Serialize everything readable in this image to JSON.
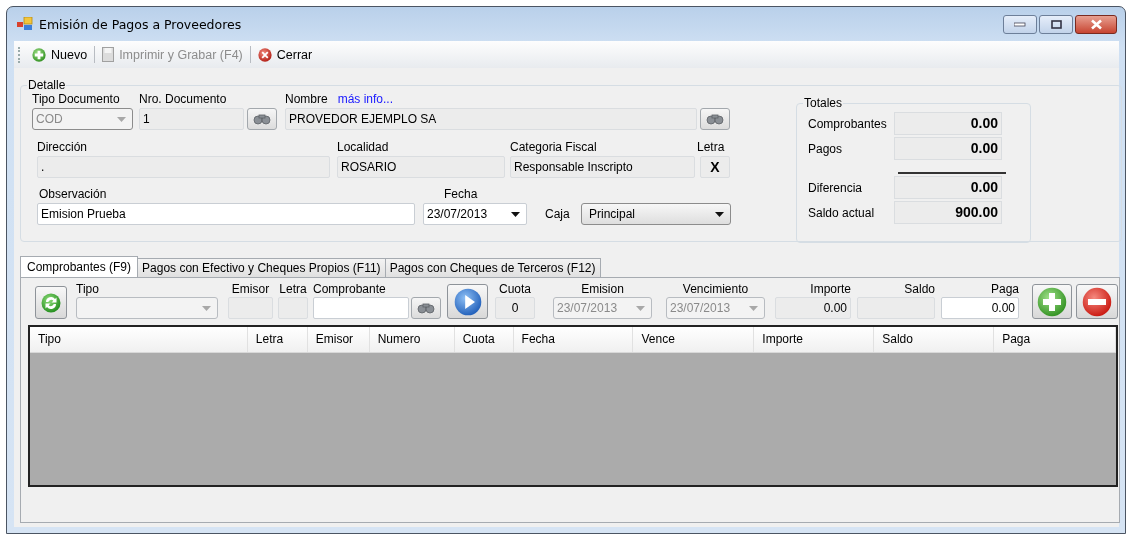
{
  "window": {
    "title": "Emisión de Pagos a Proveedores"
  },
  "toolbar": [
    {
      "kind": "new",
      "label": "Nuevo",
      "disabled": false
    },
    {
      "kind": "print",
      "label": "Imprimir y Grabar (F4)",
      "disabled": true
    },
    {
      "kind": "close",
      "label": "Cerrar",
      "disabled": false
    }
  ],
  "detalle": {
    "title": "Detalle",
    "tipo_documento": {
      "label": "Tipo Documento",
      "value": "COD",
      "disabled": true
    },
    "nro_documento": {
      "label": "Nro. Documento",
      "value": "1",
      "disabled": true
    },
    "nombre": {
      "label": "Nombre",
      "link": "más info...",
      "value": "PROVEDOR EJEMPLO SA",
      "disabled": true
    },
    "direccion": {
      "label": "Dirección",
      "value": ".",
      "disabled": true
    },
    "localidad": {
      "label": "Localidad",
      "value": "ROSARIO",
      "disabled": true
    },
    "categoria_fiscal": {
      "label": "Categoria Fiscal",
      "value": "Responsable Inscripto",
      "disabled": true
    },
    "letra": {
      "label": "Letra",
      "value": "X",
      "disabled": true
    },
    "observacion": {
      "label": "Observación",
      "value": "Emision Prueba",
      "disabled": false
    },
    "fecha": {
      "label": "Fecha",
      "value": "23/07/2013",
      "disabled": false
    },
    "caja": {
      "label": "Caja",
      "value": "Principal",
      "disabled": false
    }
  },
  "totales": {
    "title": "Totales",
    "rows": [
      {
        "label": "Comprobantes",
        "value": "0.00"
      },
      {
        "label": "Pagos",
        "value": "0.00"
      }
    ],
    "result_rows": [
      {
        "label": "Diferencia",
        "value": "0.00"
      },
      {
        "label": "Saldo actual",
        "value": "900.00"
      }
    ]
  },
  "tabs": [
    {
      "label": "Comprobantes (F9)",
      "selected": true
    },
    {
      "label": "Pagos con Efectivo y Cheques Propios (F11)",
      "selected": false
    },
    {
      "label": "Pagos con Cheques de Terceros  (F12)",
      "selected": false
    }
  ],
  "entry": [
    {
      "kind": "refresh"
    },
    {
      "kind": "combo",
      "label": "Tipo",
      "disabled": true
    },
    {
      "kind": "text",
      "label": "Emisor",
      "disabled": true
    },
    {
      "kind": "text",
      "label": "Letra",
      "disabled": true
    },
    {
      "kind": "text",
      "label": "Comprobante",
      "disabled": false
    },
    {
      "kind": "search"
    },
    {
      "kind": "play"
    },
    {
      "kind": "text",
      "label": "Cuota",
      "value": "0",
      "disabled": true
    },
    {
      "kind": "combo",
      "label": "Emision",
      "value": "23/07/2013",
      "disabled": true
    },
    {
      "kind": "combo",
      "label": "Vencimiento",
      "value": "23/07/2013",
      "disabled": true
    },
    {
      "kind": "number",
      "label": "Importe",
      "value": "0.00",
      "disabled": true
    },
    {
      "kind": "number",
      "label": "Saldo",
      "disabled": true
    },
    {
      "kind": "number",
      "label": "Paga",
      "value": "0.00",
      "disabled": false
    },
    {
      "kind": "add"
    },
    {
      "kind": "remove"
    }
  ],
  "grid": {
    "columns": [
      "Tipo",
      "Letra",
      "Emisor",
      "Numero",
      "Cuota",
      "Fecha",
      "Vence",
      "Importe",
      "Saldo",
      "Paga"
    ]
  }
}
